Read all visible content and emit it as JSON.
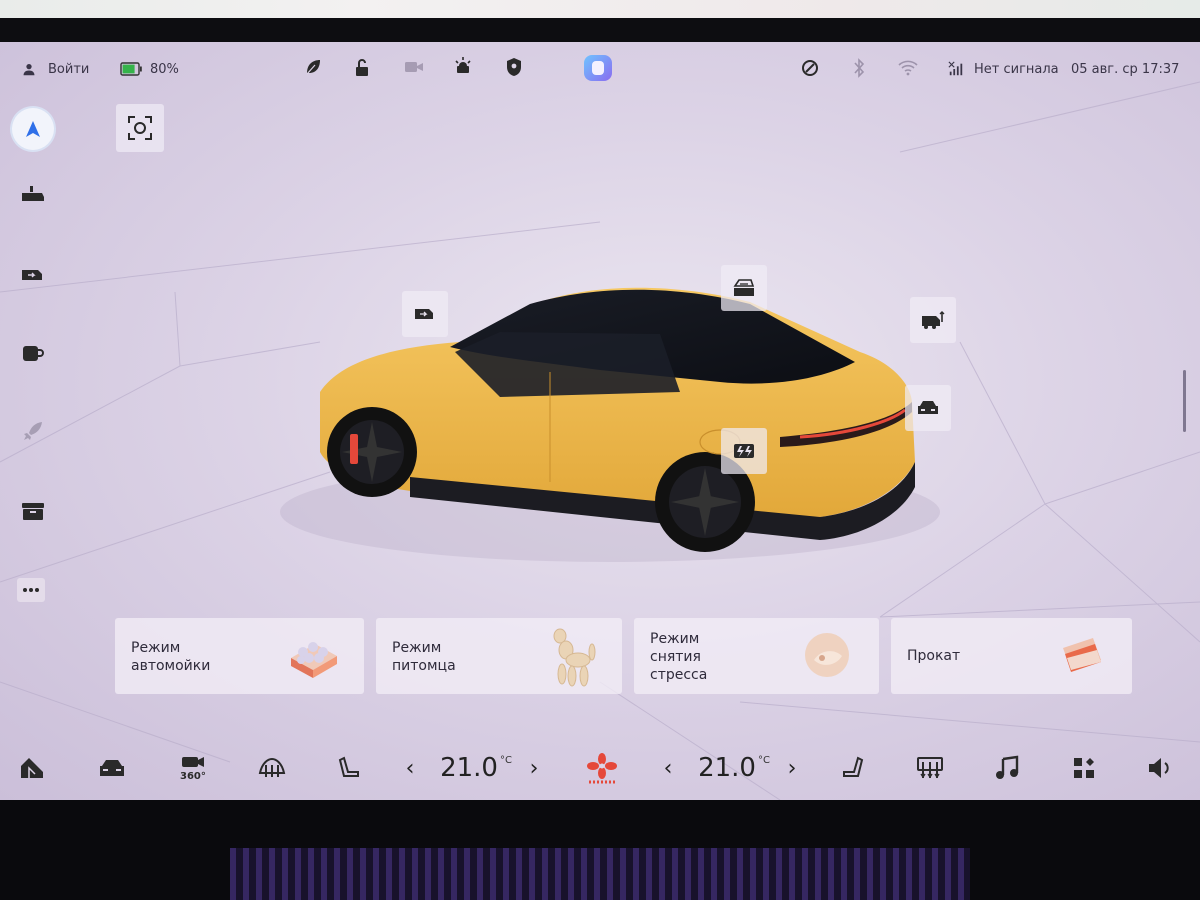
{
  "status": {
    "login_label": "Войти",
    "battery_percent": "80%",
    "battery_level": 0.8,
    "signal_label": "Нет сигнала",
    "datetime": "05 авг. ср 17:37"
  },
  "cards": [
    {
      "lines": [
        "Режим",
        "автомойки"
      ]
    },
    {
      "lines": [
        "Режим",
        "питомца"
      ]
    },
    {
      "lines": [
        "Режим",
        "снятия",
        "стресса"
      ]
    },
    {
      "lines": [
        "Прокат"
      ]
    }
  ],
  "climate": {
    "driver_temp": "21.0",
    "passenger_temp": "21.0",
    "unit": "°C"
  },
  "colors": {
    "accent_blue": "#2f6fe8",
    "car_yellow": "#f0b947",
    "fan_red": "#e5483a",
    "battery_green": "#35b34a"
  },
  "icons": {
    "status": [
      "user-icon",
      "battery-icon",
      "eco-leaf-icon",
      "unlock-icon",
      "dashcam-icon",
      "hazard-icon",
      "shield-icon",
      "assistant-logo-icon",
      "location-sync-icon",
      "bluetooth-icon",
      "wifi-icon",
      "no-signal-icon"
    ],
    "rail": [
      "navigation-icon",
      "mirror-icon",
      "camera-icon",
      "cup-icon",
      "rocket-icon",
      "storage-icon",
      "more-icon"
    ],
    "dock": [
      "home-icon",
      "car-icon",
      "camera-360-icon",
      "rear-defrost-icon",
      "driver-seat-icon",
      "fan-icon",
      "passenger-seat-icon",
      "front-defrost-icon",
      "music-icon",
      "apps-icon",
      "volume-icon"
    ]
  }
}
